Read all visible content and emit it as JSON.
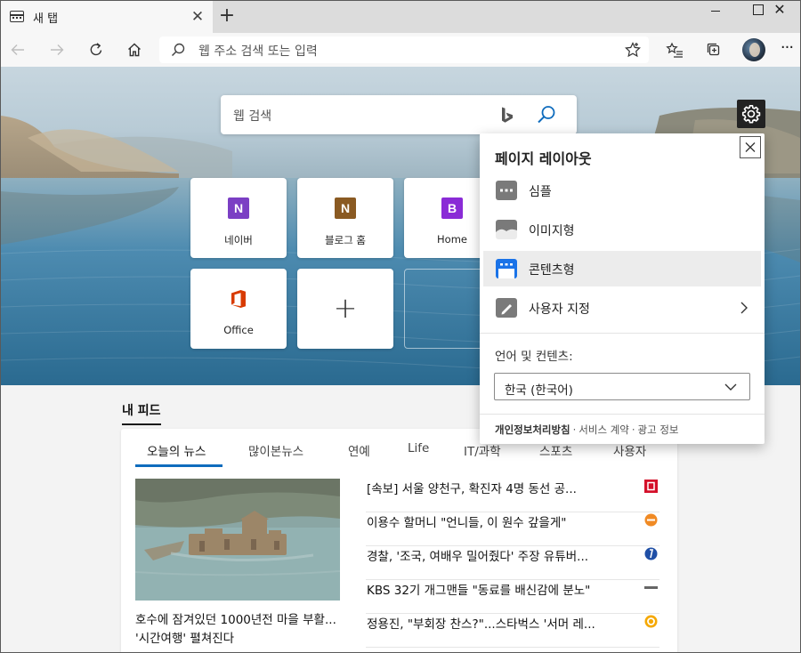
{
  "browser": {
    "tab_title": "새 탭",
    "address_placeholder": "웹 주소 검색 또는 입력"
  },
  "newtab": {
    "search_placeholder": "웹 검색",
    "tiles": [
      {
        "label": "네이버",
        "letter": "N",
        "color": "#7b3fc4"
      },
      {
        "label": "블로그 홈",
        "letter": "N",
        "color": "#8a5a22"
      },
      {
        "label": "Home",
        "letter": "B",
        "color": "#8a2bd6"
      },
      {
        "label": "Office",
        "letter": "",
        "color": "#d83b01"
      }
    ]
  },
  "feed": {
    "title": "내 피드",
    "tabs": [
      "오늘의 뉴스",
      "많이본뉴스",
      "연예",
      "Life",
      "IT/과학",
      "스포츠",
      "사용자"
    ],
    "lead_headline": "호수에 잠겨있던 1000년전 마을 부활... '시간여행' 펼쳐진다",
    "articles": [
      {
        "title": "[속보] 서울 양천구, 확진자 4명 동선 공...",
        "source_color": "#d4102a"
      },
      {
        "title": "이용수 할머니 \"언니들, 이 원수 갚을게\"",
        "source_color": "#f08a24"
      },
      {
        "title": "경찰, '조국, 여배우 밀어줬다' 주장 유튜버...",
        "source_color": "#1f4fa6"
      },
      {
        "title": "KBS 32기 개그맨들 \"동료를 배신감에 분노\"",
        "source_color": "#333333"
      },
      {
        "title": "정용진, \"부회장 찬스?\"...스타벅스 '서머 레...",
        "source_color": "#f5a800"
      }
    ]
  },
  "layout_panel": {
    "title": "페이지 레이아웃",
    "options": [
      {
        "label": "심플",
        "icon": "simple-layout-icon"
      },
      {
        "label": "이미지형",
        "icon": "image-layout-icon"
      },
      {
        "label": "콘텐츠형",
        "icon": "content-layout-icon",
        "selected": true
      },
      {
        "label": "사용자 지정",
        "icon": "custom-layout-icon"
      }
    ],
    "language_label": "언어 및 컨텐츠:",
    "language_value": "한국 (한국어)",
    "footer": {
      "privacy": "개인정보처리방침",
      "terms": "서비스 계약",
      "ads": "광고 정보",
      "separator": "·"
    }
  },
  "colors": {
    "accent": "#0f6cbd",
    "selected_layout": "#1a73e8"
  }
}
